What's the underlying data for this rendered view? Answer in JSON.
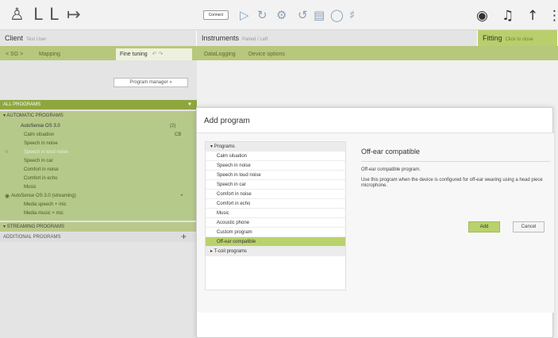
{
  "toolbar": {
    "icons": [
      "user-icon",
      "hearing-aid-left-icon",
      "hearing-aid-right-icon",
      "export-icon"
    ],
    "connect_label": "Connect",
    "right_icons": [
      "play-icon",
      "audiogram-icon",
      "settings-icon",
      "refresh-icon",
      "save-icon",
      "sync-icon",
      "globe-icon",
      "help-icon",
      "info-icon"
    ]
  },
  "headers": {
    "client": "Client",
    "client_sub": "Test User",
    "instruments": "Instruments",
    "instruments_sub": "Paired / Left",
    "fitting": "Fitting",
    "fitting_sub": "Click to close"
  },
  "tabs": {
    "nav": "< SG >",
    "mapping": "Mapping",
    "fine_tuning": "Fine tuning",
    "right_tabs": [
      "DataLogging",
      "Device options"
    ]
  },
  "left": {
    "program_manager": "Program manager",
    "all_programs": "ALL PROGRAMS",
    "automatic_programs": "AUTOMATIC PROGRAMS",
    "autosense_label": "AutoSense OS 3.0",
    "autosense_badge": "(2)",
    "calm_badge": "CB",
    "programs": [
      "Calm situation",
      "Speech in noise",
      "Speech in loud noise",
      "Speech in car",
      "Comfort in noise",
      "Comfort in echo",
      "Music"
    ],
    "streaming_label": "AutoSense OS 3.0 (streaming)",
    "streaming_children": [
      "Media speech + mic",
      "Media music + mic"
    ],
    "streaming_programs": "STREAMING PROGRAMS",
    "additional_programs": "ADDITIONAL PROGRAMS",
    "add_symbol": "+"
  },
  "modal": {
    "title": "Add program",
    "groups": {
      "programs": "Programs",
      "tcoil": "T-coil programs"
    },
    "items": [
      "Calm situation",
      "Speech in noise",
      "Speech in loud noise",
      "Speech in car",
      "Comfort in noise",
      "Comfort in echo",
      "Music",
      "Acoustic phone",
      "Custom program",
      "Off-ear compatible"
    ],
    "selected_index": 9,
    "detail_title": "Off-ear compatible",
    "detail_line1": "Off-ear compatible program.",
    "detail_line2": "Use this program when the device is configured for off-ear wearing using a head piece microphone.",
    "add_label": "Add",
    "cancel_label": "Cancel"
  },
  "colors": {
    "accent_green": "#b9d26b",
    "section_green": "#8fa63f",
    "tab_green": "#b7c77c"
  }
}
